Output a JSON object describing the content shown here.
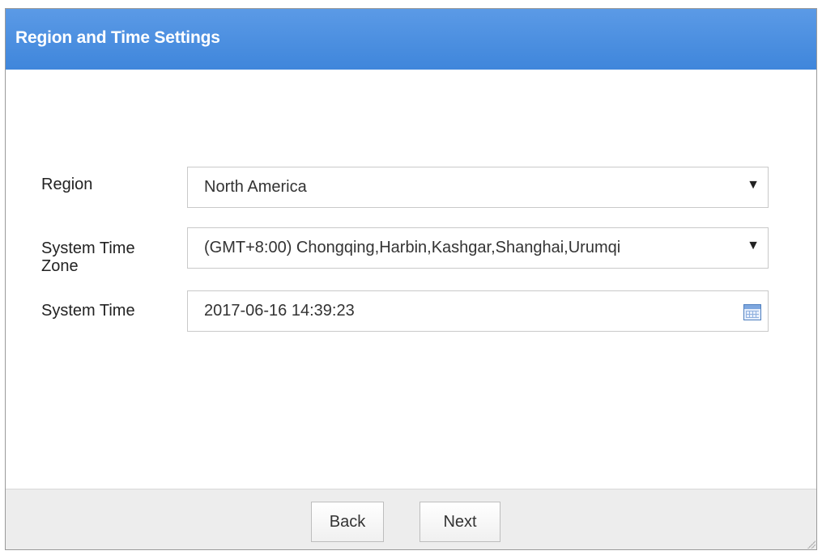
{
  "dialog": {
    "title": "Region and Time Settings"
  },
  "form": {
    "region": {
      "label": "Region",
      "value": "North America",
      "arrow": "▼"
    },
    "time_zone": {
      "label_line1": "System Time",
      "label_line2": "Zone",
      "value": "(GMT+8:00) Chongqing,Harbin,Kashgar,Shanghai,Urumqi",
      "arrow": "▼"
    },
    "system_time": {
      "label": "System Time",
      "value": "2017-06-16 14:39:23",
      "icon": "calendar-icon"
    }
  },
  "footer": {
    "back_label": "Back",
    "next_label": "Next"
  },
  "colors": {
    "titlebar": "#4a8fe0",
    "footer": "#ededed"
  }
}
